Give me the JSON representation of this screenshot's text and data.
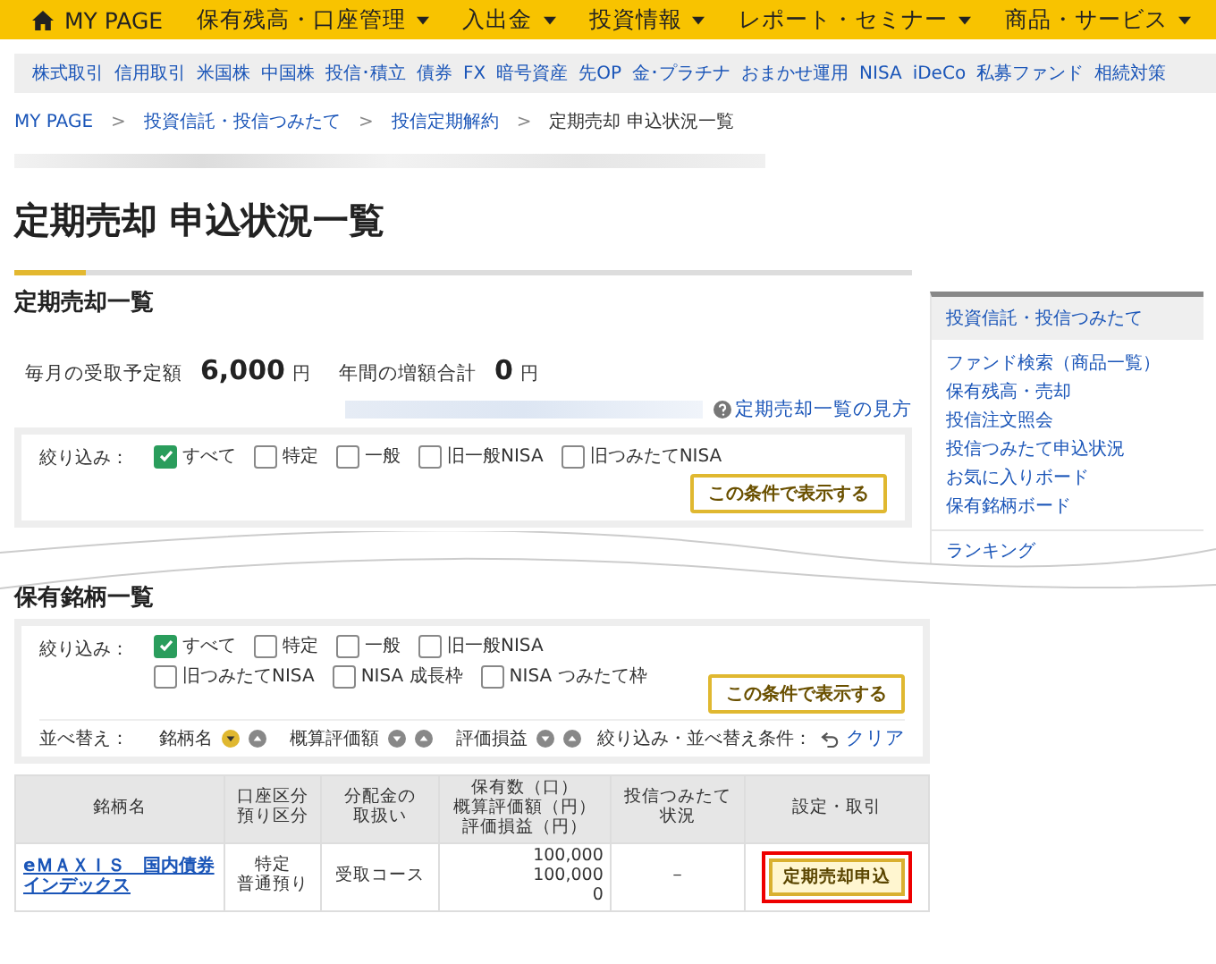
{
  "nav": {
    "home": "MY PAGE",
    "items": [
      "保有残高・口座管理",
      "入出金",
      "投資情報",
      "レポート・セミナー",
      "商品・サービス"
    ]
  },
  "subnav": [
    "株式取引",
    "信用取引",
    "米国株",
    "中国株",
    "投信･積立",
    "債券",
    "FX",
    "暗号資産",
    "先OP",
    "金･プラチナ",
    "おまかせ運用",
    "NISA",
    "iDeCo",
    "私募ファンド",
    "相続対策"
  ],
  "breadcrumb_separator": ">",
  "breadcrumb": [
    {
      "label": "MY PAGE",
      "link": true
    },
    {
      "label": "投資信託・投信つみたて",
      "link": true
    },
    {
      "label": "投信定期解約",
      "link": true
    },
    {
      "label": "定期売却 申込状況一覧",
      "link": false
    }
  ],
  "page_title": "定期売却 申込状況一覧",
  "sale_section": {
    "heading": "定期売却一覧",
    "summary": [
      {
        "label": "毎月の受取予定額",
        "value": "6,000",
        "unit": "円"
      },
      {
        "label": "年間の増額合計",
        "value": "0",
        "unit": "円"
      }
    ],
    "help_link": "定期売却一覧の見方",
    "filter": {
      "label": "絞り込み：",
      "options": [
        {
          "label": "すべて",
          "checked": true
        },
        {
          "label": "特定",
          "checked": false
        },
        {
          "label": "一般",
          "checked": false
        },
        {
          "label": "旧一般NISA",
          "checked": false
        },
        {
          "label": "旧つみたてNISA",
          "checked": false
        }
      ],
      "button": "この条件で表示する"
    }
  },
  "sidebar": {
    "heading": "投資信託・投信つみたて",
    "links": [
      "ファンド検索（商品一覧）",
      "保有残高・売却",
      "投信注文照会",
      "投信つみたて申込状況",
      "お気に入りボード",
      "保有銘柄ボード"
    ],
    "next_heading": "ランキング"
  },
  "holdings_section": {
    "heading": "保有銘柄一覧",
    "filter": {
      "label": "絞り込み：",
      "options": [
        {
          "label": "すべて",
          "checked": true
        },
        {
          "label": "特定",
          "checked": false
        },
        {
          "label": "一般",
          "checked": false
        },
        {
          "label": "旧一般NISA",
          "checked": false
        },
        {
          "label": "旧つみたてNISA",
          "checked": false
        },
        {
          "label": "NISA 成長枠",
          "checked": false
        },
        {
          "label": "NISA つみたて枠",
          "checked": false
        }
      ],
      "button": "この条件で表示する"
    },
    "sort": {
      "label": "並べ替え：",
      "keys": [
        {
          "label": "銘柄名",
          "selected": true
        },
        {
          "label": "概算評価額",
          "selected": false
        },
        {
          "label": "評価損益",
          "selected": false
        }
      ],
      "conditions_label": "絞り込み・並べ替え条件：",
      "clear": "クリア"
    }
  },
  "table": {
    "columns": [
      [
        "銘柄名"
      ],
      [
        "口座区分",
        "預り区分"
      ],
      [
        "分配金の",
        "取扱い"
      ],
      [
        "保有数（口）",
        "概算評価額（円）",
        "評価損益（円）"
      ],
      [
        "投信つみたて",
        "状況"
      ],
      [
        "設定・取引"
      ]
    ],
    "rows": [
      {
        "name": "eＭＡＸＩＳ　国内債券インデックス",
        "account": [
          "特定",
          "普通預り"
        ],
        "dividend": "受取コース",
        "amounts": [
          "100,000",
          "100,000",
          "0"
        ],
        "status": "－",
        "action": "定期売却申込",
        "highlighted": true
      }
    ]
  }
}
